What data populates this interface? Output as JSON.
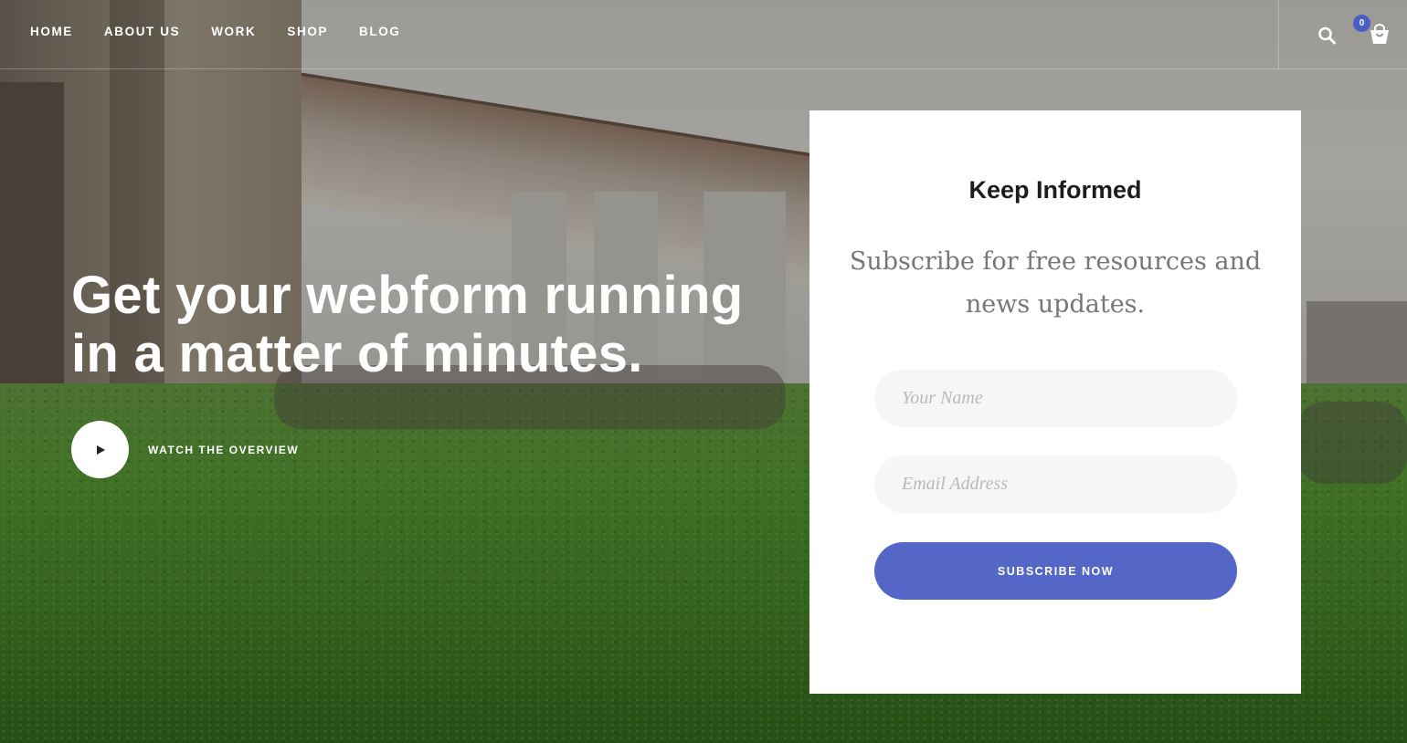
{
  "nav": {
    "items": [
      {
        "label": "HOME"
      },
      {
        "label": "ABOUT US"
      },
      {
        "label": "WORK"
      },
      {
        "label": "SHOP"
      },
      {
        "label": "BLOG"
      }
    ],
    "search_icon": "search-icon",
    "cart_icon": "shopping-bag-icon",
    "cart_count": "0"
  },
  "hero": {
    "title": "Get your webform running in a matter of minutes.",
    "play_icon": "play-icon",
    "watch_label": "WATCH THE OVERVIEW"
  },
  "form": {
    "title": "Keep Informed",
    "subtitle": "Subscribe for free resources and news updates.",
    "name_placeholder": "Your Name",
    "name_value": "",
    "email_placeholder": "Email Address",
    "email_value": "",
    "submit_label": "SUBSCRIBE NOW"
  },
  "colors": {
    "accent": "#5567c6",
    "badge": "#4a5fc1",
    "card_bg": "#ffffff",
    "field_bg": "#f6f6f6"
  }
}
